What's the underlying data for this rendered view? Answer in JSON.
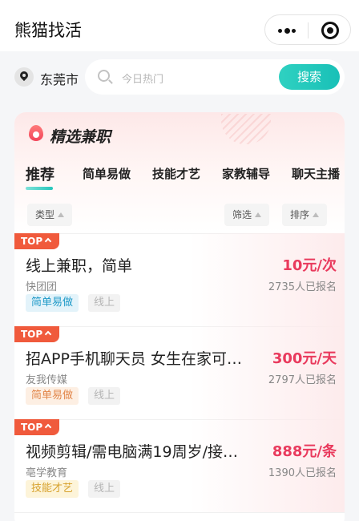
{
  "nav": {
    "title": "熊猫找活"
  },
  "location": {
    "city": "东莞市"
  },
  "search": {
    "placeholder": "今日热门",
    "button": "搜索"
  },
  "section": {
    "title": "精选兼职",
    "tabs": [
      "推荐",
      "简单易做",
      "技能才艺",
      "家教辅导",
      "聊天主播"
    ],
    "active_tab": "推荐",
    "filters": {
      "type": "类型",
      "filter": "筛选",
      "sort": "排序"
    }
  },
  "jobs": [
    {
      "badge": "TOP",
      "title": "线上兼职，简单",
      "company": "快团团",
      "salary": "10元/次",
      "signups": "2735人已报名",
      "tags": [
        "简单易做",
        "线上"
      ]
    },
    {
      "badge": "TOP",
      "title": "招APP手机聊天员 女生在家可…",
      "company": "友我传媒",
      "salary": "300元/天",
      "signups": "2797人已报名",
      "tags": [
        "简单易做",
        "线上"
      ]
    },
    {
      "badge": "TOP",
      "title": "视频剪辑/需电脑满19周岁/接…",
      "company": "亳学教育",
      "salary": "888元/条",
      "signups": "1390人已报名",
      "tags": [
        "技能才艺",
        "线上"
      ]
    }
  ],
  "colors": {
    "accent": "#24c6bb",
    "salary": "#e93a5d",
    "badge": "#f05a3c"
  }
}
